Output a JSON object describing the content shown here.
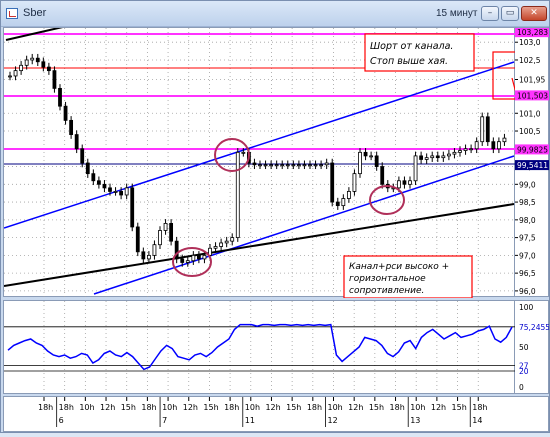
{
  "window": {
    "title": "Sber",
    "timeframe": "15 минут",
    "minimize_glyph": "–",
    "restore_glyph": "▭",
    "close_glyph": "✕"
  },
  "colors": {
    "candle": "#000000",
    "channel": "#0000ff",
    "horizontal_level": "#ff33ff",
    "base_line": "#000000",
    "dark_level": "#000080",
    "highlight_circle": "#b0305a",
    "annotation_border": "#ff0000",
    "rsi_line": "#0000ff",
    "grid": "#a0a0a0"
  },
  "annotations": {
    "short_note_line1": "Шорт от канала.",
    "short_note_line2": "Стоп выше хая.",
    "channel_note_line1": "Канал+рси высоко +",
    "channel_note_line2": "горизонтальное",
    "channel_note_line3": "сопротивление."
  },
  "chart_data": [
    {
      "type": "candlestick",
      "title": "Sber",
      "ylim": [
        95.8,
        103.4
      ],
      "price_ticks": [
        "103,0",
        "102,5",
        "101,95",
        "101,5",
        "101,0",
        "100,5",
        "99,5",
        "99,0",
        "98,5",
        "98,0",
        "97,5",
        "97,0",
        "96,5",
        "96,0"
      ],
      "highlighted_levels": [
        {
          "value": "103,283",
          "style": "magenta"
        },
        {
          "value": "101,503",
          "style": "magenta"
        },
        {
          "value": "99,9825",
          "style": "magenta"
        },
        {
          "value": "99,5411",
          "style": "navy"
        }
      ],
      "close_series": [
        102.05,
        102.2,
        102.35,
        102.5,
        102.55,
        102.45,
        102.3,
        102.2,
        101.7,
        101.2,
        100.8,
        100.4,
        100.0,
        99.6,
        99.3,
        99.1,
        99.0,
        98.9,
        98.8,
        98.8,
        98.7,
        98.9,
        97.8,
        97.1,
        96.9,
        97.0,
        97.3,
        97.7,
        97.9,
        97.4,
        96.9,
        96.8,
        96.85,
        97.0,
        96.9,
        97.0,
        97.2,
        97.25,
        97.35,
        97.4,
        97.5,
        99.9,
        99.9,
        99.6,
        99.55,
        99.55,
        99.55,
        99.55,
        99.55,
        99.55,
        99.55,
        99.55,
        99.55,
        99.55,
        99.55,
        99.55,
        99.55,
        99.6,
        98.5,
        98.4,
        98.6,
        98.8,
        99.3,
        99.9,
        99.8,
        99.8,
        99.5,
        99.0,
        98.9,
        98.9,
        99.1,
        99.0,
        99.1,
        99.8,
        99.7,
        99.75,
        99.8,
        99.75,
        99.8,
        99.85,
        99.9,
        99.95,
        100.0,
        100.0,
        100.2,
        100.9,
        100.2,
        100.0,
        100.2,
        100.3
      ],
      "day_labels": [
        "6",
        "7",
        "11",
        "12",
        "13",
        "14"
      ],
      "hour_labels": [
        "18h",
        "18h",
        "10h",
        "12h",
        "15h",
        "18h",
        "10h",
        "12h",
        "15h",
        "18h",
        "10h",
        "12h",
        "15h",
        "18h",
        "10h",
        "12h",
        "15h",
        "18h",
        "10h",
        "12h",
        "15h",
        "18h"
      ]
    },
    {
      "type": "line",
      "title": "RSI",
      "ylim": [
        0,
        100
      ],
      "ticks": [
        "100",
        "75,2455",
        "50",
        "27",
        "20",
        "0"
      ],
      "reference_levels": [
        20,
        27,
        75.2455
      ],
      "values": [
        46,
        52,
        55,
        58,
        60,
        55,
        52,
        45,
        40,
        38,
        40,
        36,
        38,
        42,
        40,
        30,
        34,
        42,
        45,
        40,
        38,
        43,
        38,
        30,
        22,
        25,
        35,
        45,
        52,
        48,
        38,
        36,
        34,
        40,
        42,
        38,
        43,
        50,
        55,
        60,
        72,
        78,
        78,
        78,
        76,
        78,
        78,
        77,
        78,
        78,
        77,
        78,
        77,
        78,
        77,
        78,
        77,
        78,
        40,
        32,
        38,
        44,
        50,
        62,
        60,
        58,
        52,
        42,
        38,
        44,
        55,
        58,
        48,
        62,
        68,
        72,
        66,
        60,
        64,
        68,
        62,
        64,
        66,
        70,
        72,
        76,
        60,
        56,
        62,
        75
      ]
    }
  ]
}
